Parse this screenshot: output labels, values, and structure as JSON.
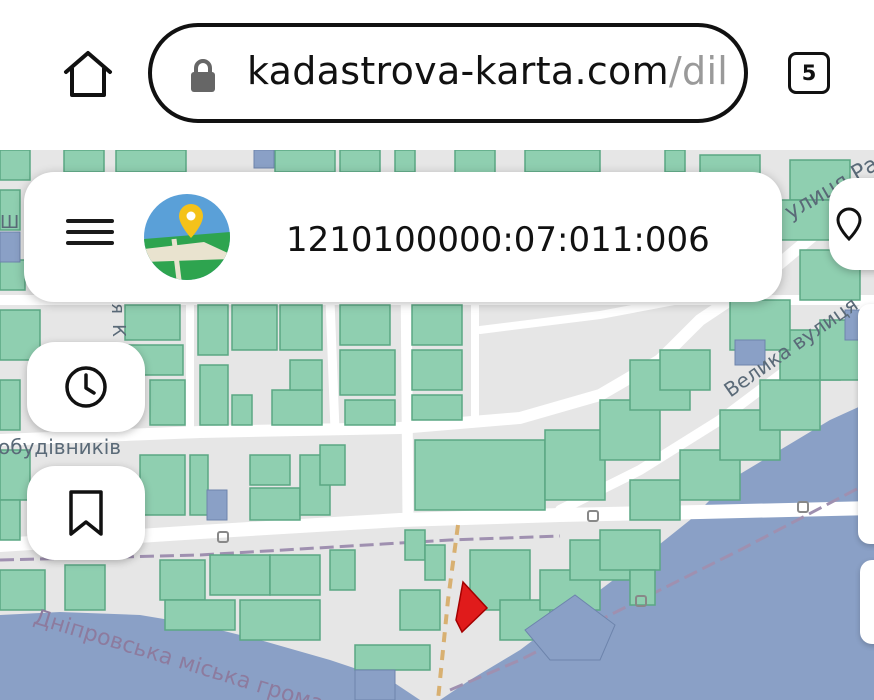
{
  "browser": {
    "url_domain": "kadastrova-karta.com",
    "url_path": "/dil",
    "tab_count": "5"
  },
  "search": {
    "value": "1210100000:07:011:006"
  },
  "map": {
    "street_labels": {
      "vulytsia_ra": "улиця Ра",
      "velyka_vulytsia": "Велика вулиця",
      "budivnykiv": "обудівників",
      "dniprovska": "Дніпровська міська грома",
      "letter_ya": "я",
      "letter_k": "К",
      "letter_sh": "Ш"
    },
    "colors": {
      "parcel": "#8fcfb0",
      "parcel_border": "#5aa783",
      "water": "#8aa0c6",
      "selected_parcel": "#e01b1b",
      "road": "#ffffff",
      "background": "#e6e6e6"
    }
  },
  "icons": {
    "home": "home-icon",
    "lock": "lock-icon",
    "menu": "hamburger-menu-icon",
    "logo": "map-pin-logo-icon",
    "history": "clock-icon",
    "bookmark": "bookmark-icon",
    "layers": "location-icon"
  }
}
